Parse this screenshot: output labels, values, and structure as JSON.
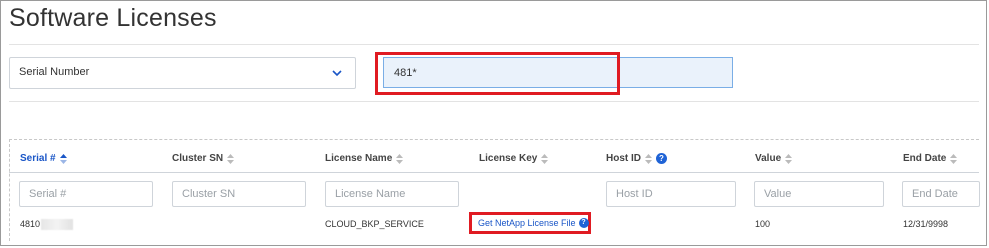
{
  "page": {
    "title": "Software Licenses"
  },
  "filter": {
    "field_label": "Serial Number",
    "search_value": "481*"
  },
  "table": {
    "columns": [
      {
        "label": "Serial #",
        "sorted": true
      },
      {
        "label": "Cluster SN"
      },
      {
        "label": "License Name"
      },
      {
        "label": "License Key"
      },
      {
        "label": "Host ID",
        "info_icon": "info-icon"
      },
      {
        "label": "Value"
      },
      {
        "label": "End Date"
      }
    ],
    "filters": {
      "serial": "Serial #",
      "cluster_sn": "Cluster SN",
      "license_name": "License Name",
      "host_id": "Host ID",
      "value": "Value",
      "end_date": "End Date"
    },
    "rows": [
      {
        "serial": "4810",
        "cluster_sn": "",
        "license_name": "CLOUD_BKP_SERVICE",
        "license_key_link": "Get NetApp License File",
        "host_id": "",
        "value": "100",
        "end_date": "12/31/9998"
      }
    ]
  },
  "colors": {
    "accent": "#1a56c7",
    "highlight": "#e01b22"
  }
}
